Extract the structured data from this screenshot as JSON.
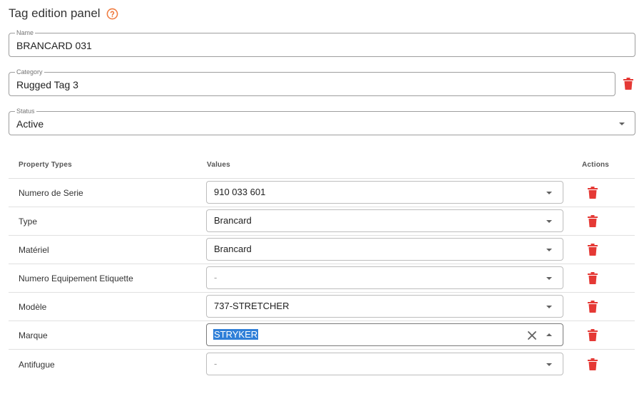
{
  "header": {
    "title": "Tag edition panel",
    "help_icon": "help-circle-icon"
  },
  "fields": {
    "name": {
      "legend": "Name",
      "value": "BRANCARD 031"
    },
    "category": {
      "legend": "Category",
      "value": "Rugged Tag 3"
    },
    "status": {
      "legend": "Status",
      "value": "Active"
    }
  },
  "table": {
    "headers": {
      "property": "Property Types",
      "values": "Values",
      "actions": "Actions"
    },
    "rows": [
      {
        "property": "Numero de Serie",
        "value": "910 033 601"
      },
      {
        "property": "Type",
        "value": "Brancard"
      },
      {
        "property": "Matériel",
        "value": "Brancard"
      },
      {
        "property": "Numero Equipement Etiquette",
        "value": "-"
      },
      {
        "property": "Modèle",
        "value": "737-STRETCHER"
      },
      {
        "property": "Marque",
        "value": "STRYKER"
      },
      {
        "property": "Antifugue",
        "value": "-"
      }
    ]
  },
  "colors": {
    "accent_orange": "#f07b3f",
    "delete_red": "#e53935",
    "selection_blue": "#2f7fd8"
  }
}
